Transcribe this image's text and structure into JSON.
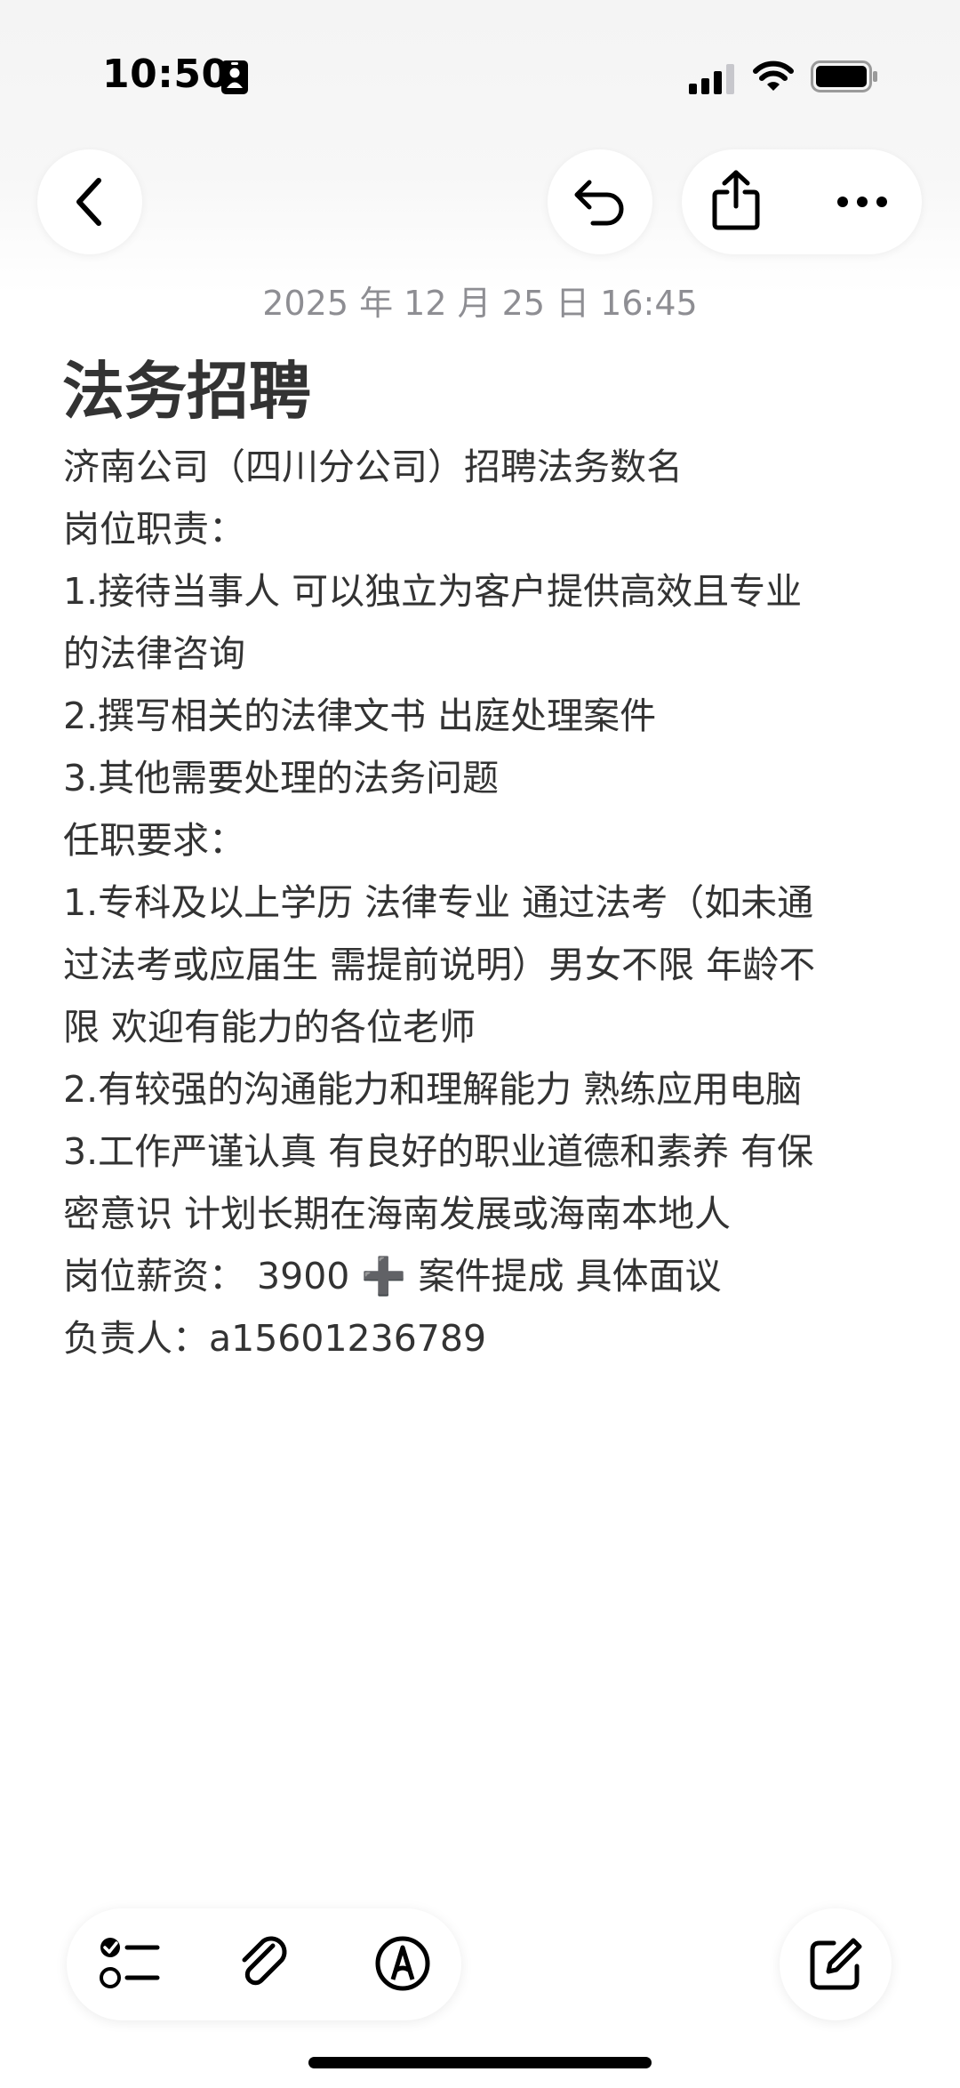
{
  "status_bar": {
    "time": "10:50"
  },
  "navigation": {
    "back_icon": "chevron-left-icon",
    "undo_icon": "undo-icon",
    "share_icon": "share-icon",
    "more_icon": "ellipsis-icon"
  },
  "note": {
    "date": "2025 年 12 月 25 日 16:45",
    "title": "法务招聘",
    "lines": [
      "济南公司（四川分公司）招聘法务数名",
      "岗位职责：",
      "1.接待当事人 可以独立为客户提供高效且专业",
      "的法律咨询",
      "2.撰写相关的法律文书 出庭处理案件",
      "3.其他需要处理的法务问题",
      "任职要求：",
      "1.专科及以上学历 法律专业 通过法考（如未通",
      "过法考或应届生 需提前说明）男女不限 年龄不",
      "限 欢迎有能力的各位老师",
      "2.有较强的沟通能力和理解能力 熟练应用电脑",
      "3.工作严谨认真 有良好的职业道德和素养  有保",
      "密意识 计划长期在海南发展或海南本地人",
      "岗位薪资：  3900 ➕ 案件提成 具体面议",
      "负责人：a15601236789"
    ]
  },
  "toolbar": {
    "checklist_icon": "checklist-icon",
    "attach_icon": "paperclip-icon",
    "markup_icon": "markup-pen-icon",
    "compose_icon": "compose-icon"
  }
}
